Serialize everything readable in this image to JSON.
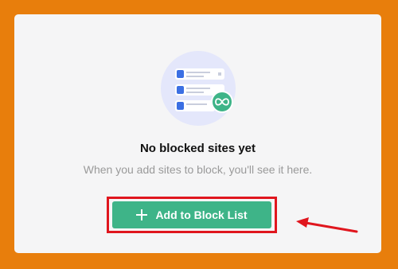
{
  "empty_state": {
    "title": "No blocked sites yet",
    "subtitle": "When you add sites to block, you'll see it here.",
    "illustration_icon": "infinity-icon"
  },
  "actions": {
    "add_button_label": "Add to Block List",
    "add_button_icon": "plus-icon"
  },
  "colors": {
    "background": "#E87E0C",
    "card": "#F5F5F6",
    "accent": "#3EB488",
    "highlight": "#E0161E",
    "illustration_circle": "#E4E7FB",
    "list_blue": "#3B6FE3"
  }
}
